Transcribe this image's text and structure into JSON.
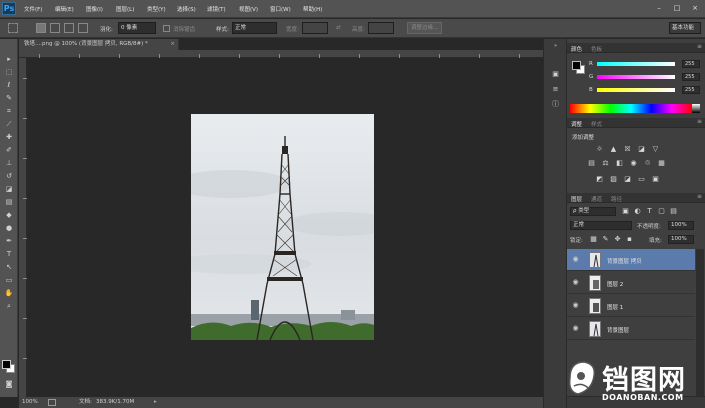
{
  "app": {
    "logo": "Ps"
  },
  "menu": [
    "文件(F)",
    "编辑(E)",
    "图像(I)",
    "图层(L)",
    "类型(Y)",
    "选择(S)",
    "滤镜(T)",
    "视图(V)",
    "窗口(W)",
    "帮助(H)"
  ],
  "window_controls": {
    "minimize": "–",
    "maximize": "□",
    "close": "×"
  },
  "options": {
    "feather_label": "羽化:",
    "feather_value": "0 像素",
    "antialias_label": "消除锯齿",
    "style_label": "样式:",
    "style_value": "正常",
    "width_label": "宽度:",
    "height_label": "高度:",
    "refine_button": "调整边缘...",
    "workspace": "基本功能"
  },
  "document": {
    "tab_title": "铁塔....png @ 100% (背景图层 拷贝, RGB/8#) *",
    "close": "×"
  },
  "status": {
    "zoom": "100%",
    "doc_label": "文档:",
    "doc_size": "383.9K/1.70M"
  },
  "color_panel": {
    "tab_active": "颜色",
    "tab_inactive": "色板",
    "channels": [
      {
        "label": "R",
        "value": "255",
        "gradient_start": "#00ffff",
        "gradient_end": "#ffffff"
      },
      {
        "label": "G",
        "value": "255",
        "gradient_start": "#ff00ff",
        "gradient_end": "#ffffff"
      },
      {
        "label": "B",
        "value": "255",
        "gradient_start": "#ffff00",
        "gradient_end": "#ffffff"
      }
    ]
  },
  "adjustments_panel": {
    "tab_active": "调整",
    "tab_inactive": "样式",
    "subtitle": "添加调整"
  },
  "layers_panel": {
    "tab_active": "图层",
    "tab_inactive_1": "通道",
    "tab_inactive_2": "路径",
    "filter_value": "ρ 类型",
    "blend_mode": "正常",
    "opacity_label": "不透明度:",
    "opacity_value": "100%",
    "lock_label": "锁定:",
    "fill_label": "填充:",
    "fill_value": "100%",
    "layers": [
      {
        "name": "背景图层 拷贝",
        "selected": true
      },
      {
        "name": "图层 2",
        "selected": false
      },
      {
        "name": "图层 1",
        "selected": false
      },
      {
        "name": "背景图层",
        "selected": false
      }
    ]
  },
  "watermark": {
    "text": "铛图网",
    "url": "DOANOBAN.COM"
  },
  "colors": {
    "menu_bg": "#535353",
    "workspace_bg": "#282828",
    "panel_bg": "#3f3f3f",
    "selected_layer": "#5a7bab",
    "logo_blue": "#33a4ff"
  }
}
